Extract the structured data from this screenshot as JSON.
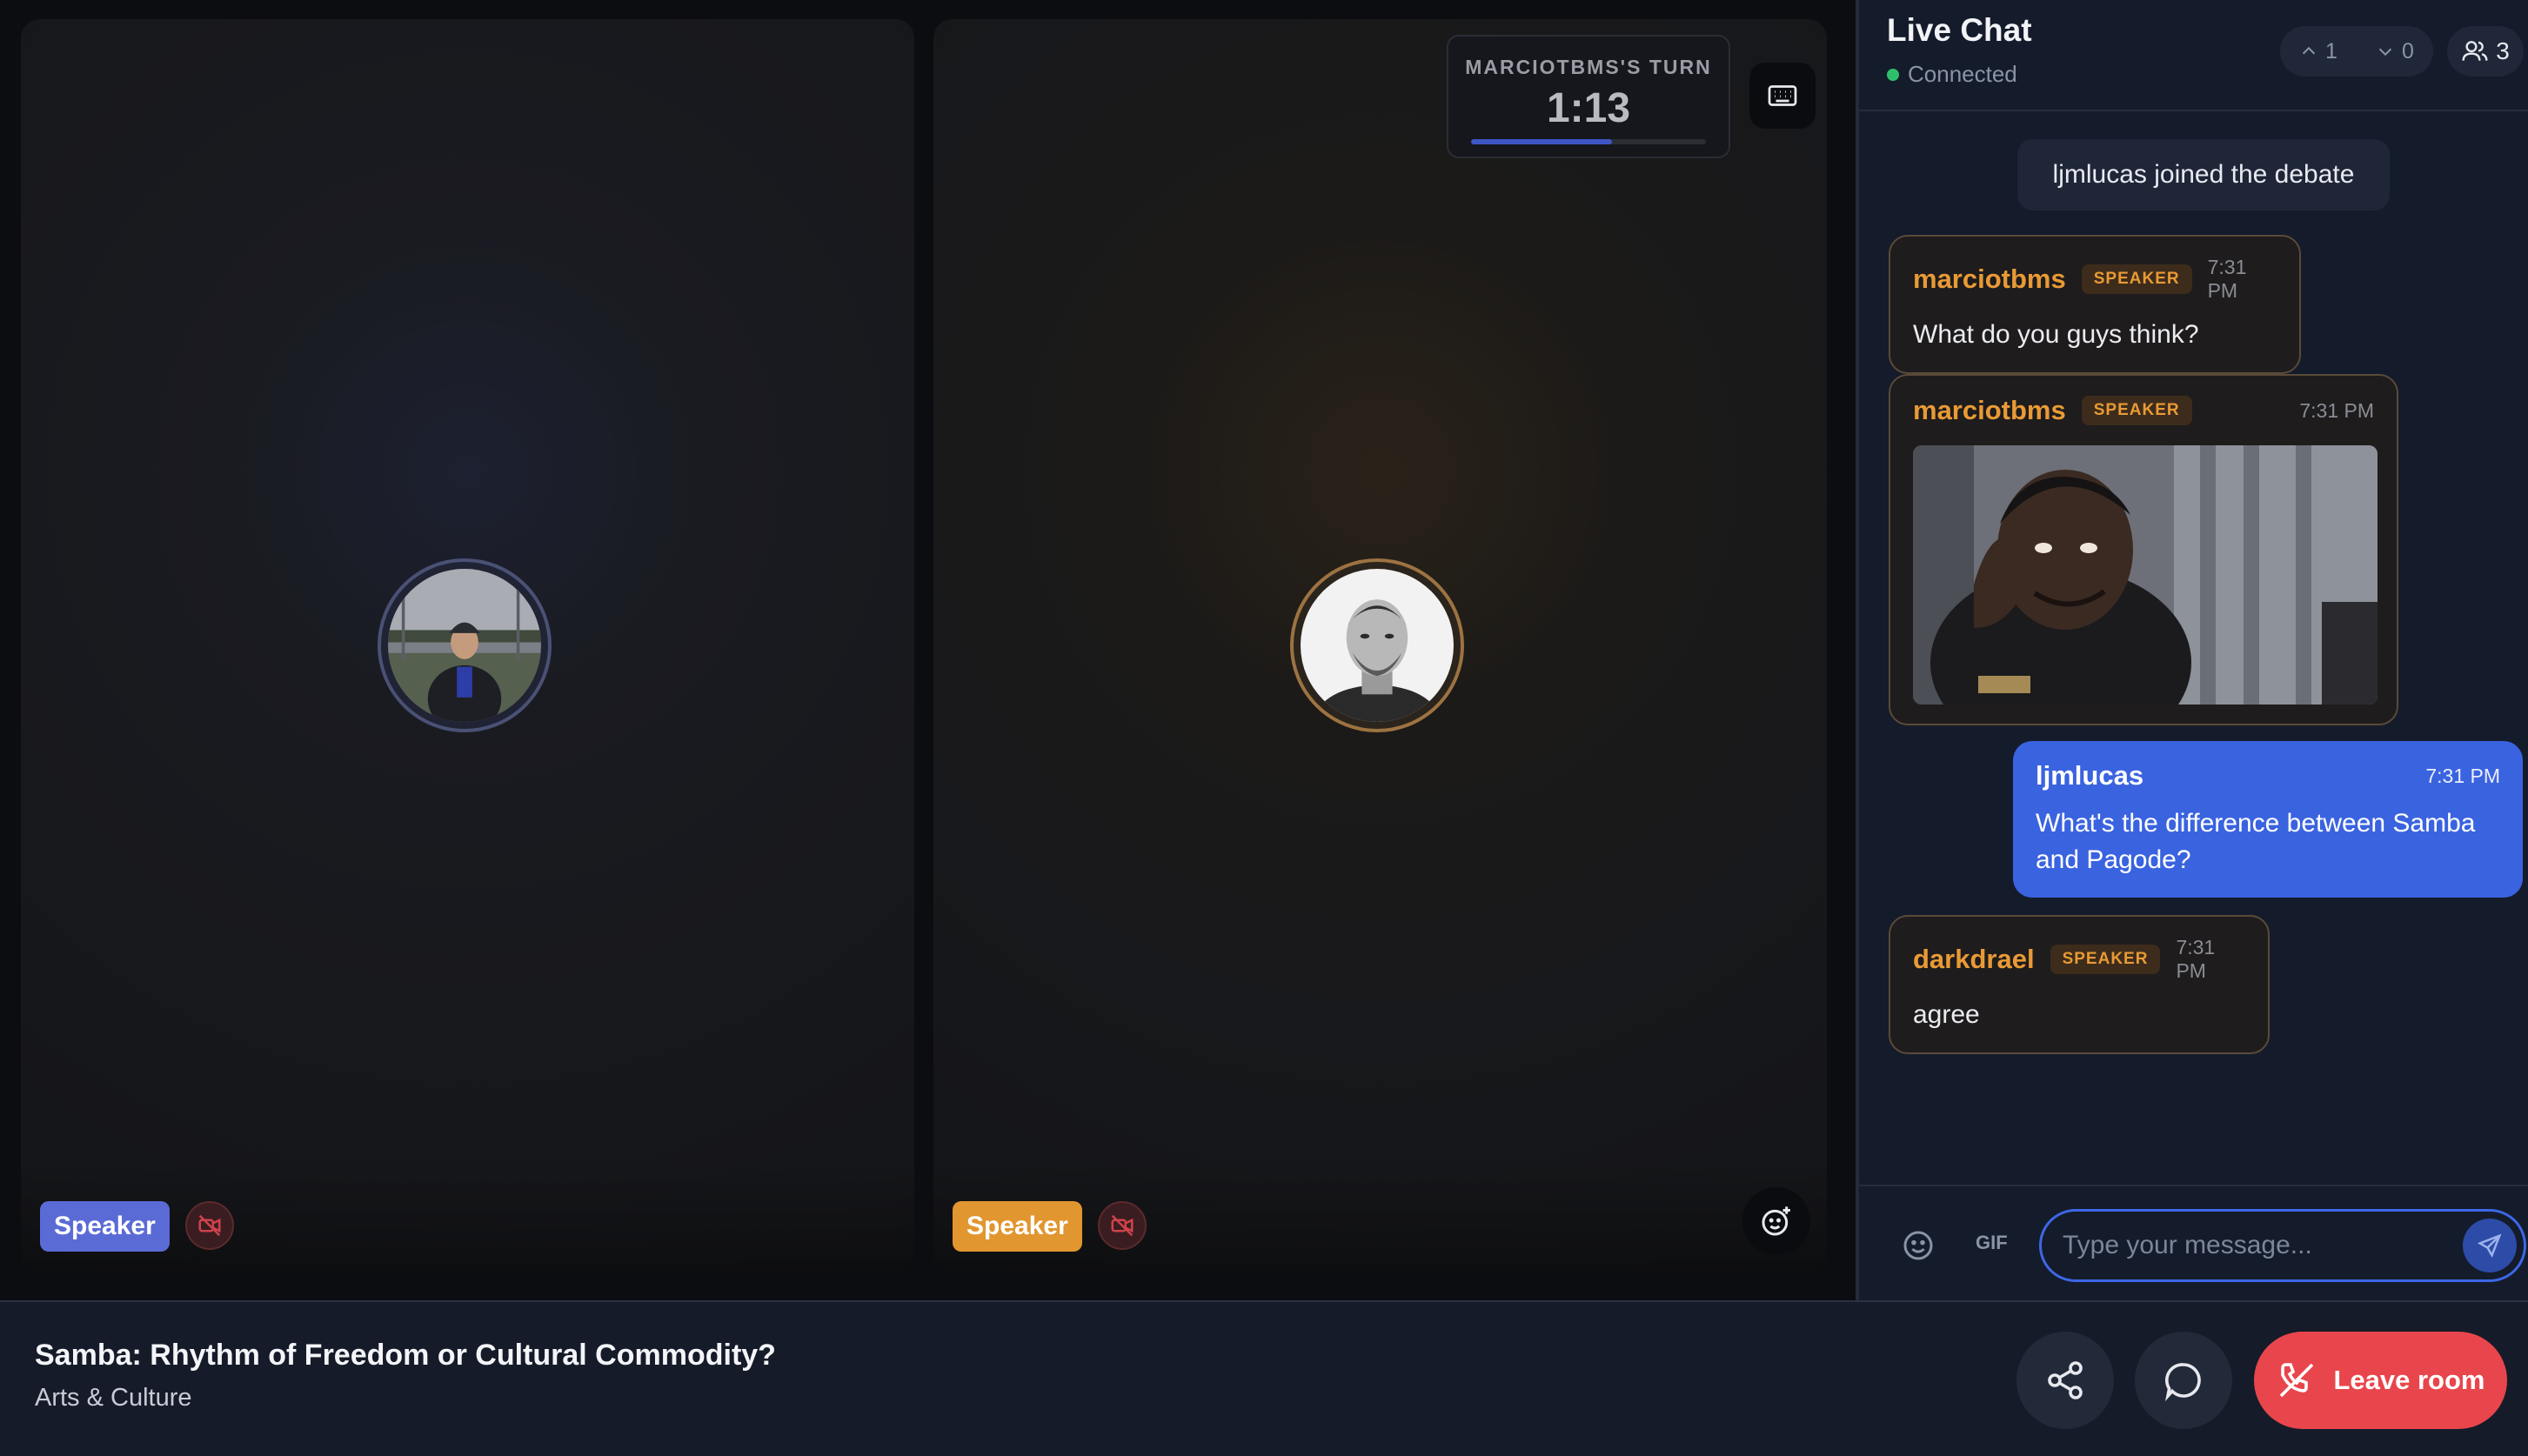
{
  "tiles": [
    {
      "badge": "Speaker",
      "accent": "#5b6bd6"
    },
    {
      "badge": "Speaker",
      "accent": "#e2962f"
    }
  ],
  "turn": {
    "label": "MARCIOTBMS'S TURN",
    "time": "1:13",
    "progress": 0.6
  },
  "chat": {
    "title": "Live Chat",
    "status": "Connected",
    "upvotes": "1",
    "downvotes": "0",
    "participants": "3",
    "system_message": "ljmlucas joined the debate",
    "messages": [
      {
        "user": "marciotbms",
        "role": "SPEAKER",
        "time": "7:31 PM",
        "text": "What do you guys think?"
      },
      {
        "user": "marciotbms",
        "role": "SPEAKER",
        "time": "7:31 PM",
        "text": ""
      },
      {
        "user": "ljmlucas",
        "time": "7:31 PM",
        "text": "What's the difference between Samba and Pagode?"
      },
      {
        "user": "darkdrael",
        "role": "SPEAKER",
        "time": "7:31 PM",
        "text": "agree"
      }
    ],
    "gif_label": "GIF",
    "input_placeholder": "Type your message..."
  },
  "room": {
    "title": "Samba: Rhythm of Freedom or Cultural Commodity?",
    "category": "Arts & Culture",
    "leave_label": "Leave room"
  },
  "colors": {
    "accent_blue": "#3a63e0",
    "speaker_orange": "#e99a35",
    "leave_red": "#e8464c",
    "connected_green": "#2fbf6b"
  }
}
